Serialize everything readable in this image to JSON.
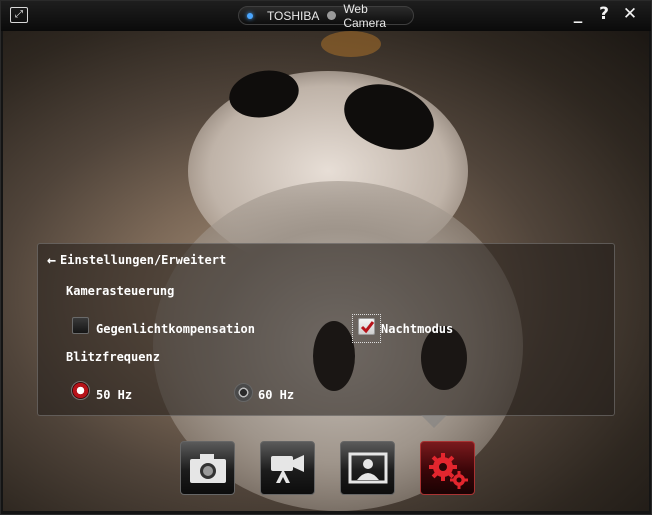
{
  "window": {
    "brand": "TOSHIBA",
    "app_name": "Web Camera",
    "buttons": {
      "minimize": "_",
      "help": "?",
      "close": "✕"
    }
  },
  "settings_panel": {
    "title": "Einstellungen/Erweitert",
    "section_camera": "Kamerasteuerung",
    "backlight_label": "Gegenlichtkompensation",
    "backlight_checked": false,
    "night_mode_label": "Nachtmodus",
    "night_mode_checked": true,
    "section_flicker": "Blitzfrequenz",
    "flicker_50": "50 Hz",
    "flicker_60": "60 Hz",
    "flicker_selected": "50 Hz"
  },
  "toolbar": {
    "items": [
      {
        "icon": "camera-icon",
        "active": false
      },
      {
        "icon": "video-camera-icon",
        "active": false
      },
      {
        "icon": "portrait-frame-icon",
        "active": false
      },
      {
        "icon": "gears-icon",
        "active": true
      }
    ]
  },
  "colors": {
    "accent": "#b7131a",
    "link_dot": "#4aa6ff"
  }
}
